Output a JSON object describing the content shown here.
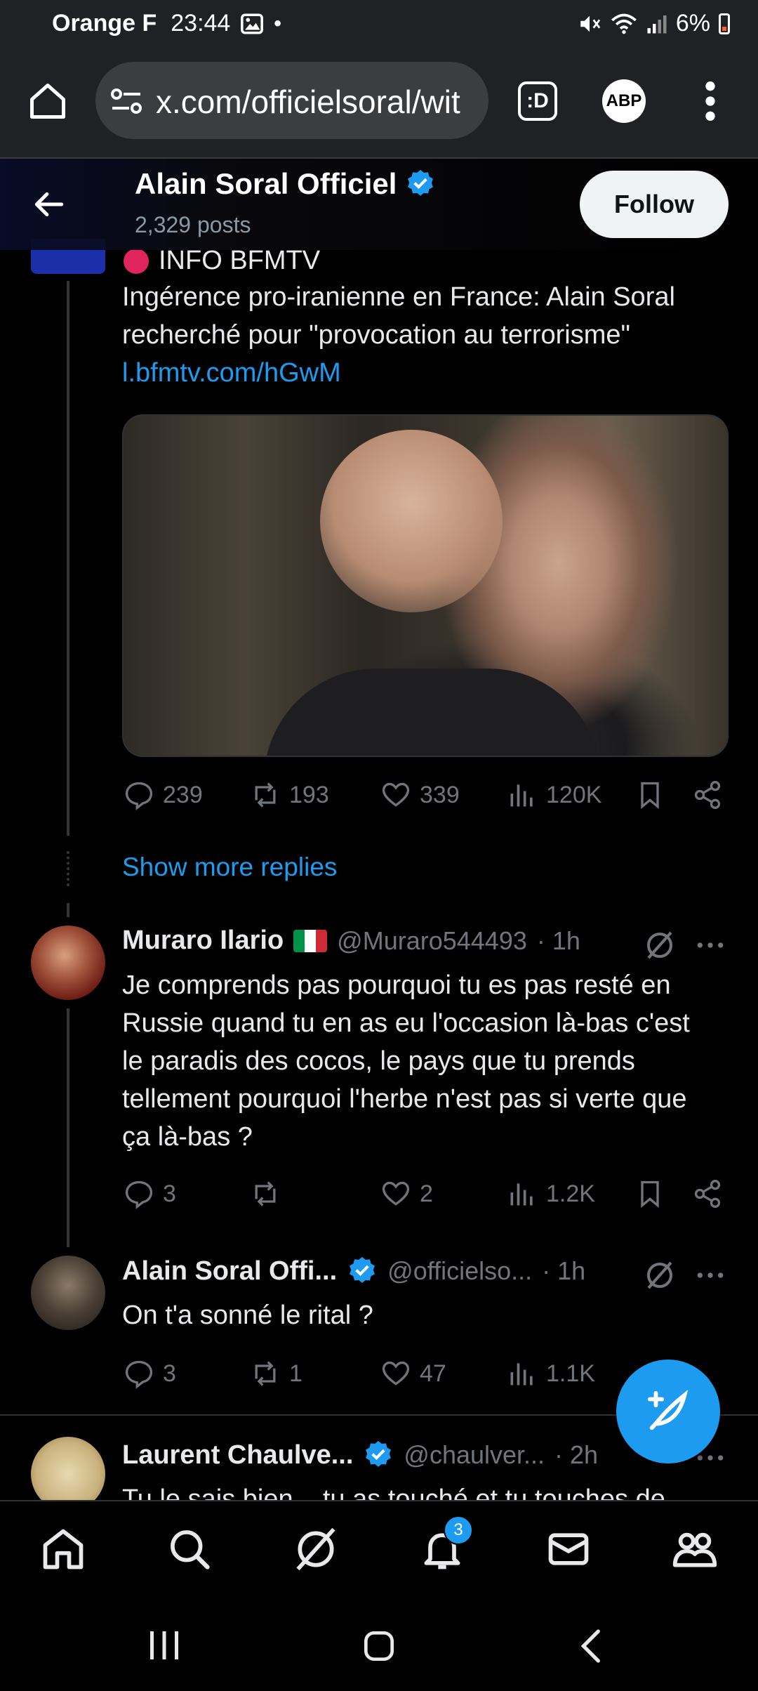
{
  "status_bar": {
    "carrier": "Orange F",
    "time": "23:44",
    "battery": "6%"
  },
  "browser": {
    "url": "x.com/officielsoral/wit",
    "ext_label": ":D",
    "abp_label": "ABP"
  },
  "profile": {
    "name": "Alain Soral Officiel",
    "posts": "2,329 posts",
    "follow_label": "Follow"
  },
  "quoted_tweet": {
    "source_label": "INFO BFMTV",
    "text_line1": "Ingérence pro-iranienne en France: Alain Soral",
    "text_line2": "recherché pour \"provocation au terrorisme\"",
    "link": "l.bfmtv.com/hGwM",
    "stats": {
      "replies": "239",
      "retweets": "193",
      "likes": "339",
      "views": "120K"
    }
  },
  "show_more_replies": "Show more replies",
  "replies": [
    {
      "name": "Muraro Ilario",
      "flag": "🇮🇹",
      "handle": "@Muraro544493",
      "time": "· 1h",
      "lines": [
        "Je comprends pas pourquoi tu es pas resté en",
        "Russie quand tu en as eu l'occasion là-bas c'est",
        "le paradis des cocos, le pays que tu prends",
        "tellement pourquoi l'herbe n'est pas si verte que",
        "ça là-bas ?"
      ],
      "stats": {
        "replies": "3",
        "retweets": "",
        "likes": "2",
        "views": "1.2K"
      }
    },
    {
      "name": "Alain Soral Offi...",
      "handle": "@officielso...",
      "time": "· 1h",
      "lines": [
        "On t'a sonné le rital ?"
      ],
      "stats": {
        "replies": "3",
        "retweets": "1",
        "likes": "47",
        "views": "1.1K"
      }
    },
    {
      "name": "Laurent Chaulve...",
      "handle": "@chaulver...",
      "time": "· 2h",
      "lines": [
        "Tu le sais bien... tu as touché et tu touches de"
      ]
    }
  ],
  "notifications_badge": "3",
  "colors": {
    "accent": "#1d9bf0",
    "muted": "#71767b",
    "background": "#000000"
  }
}
